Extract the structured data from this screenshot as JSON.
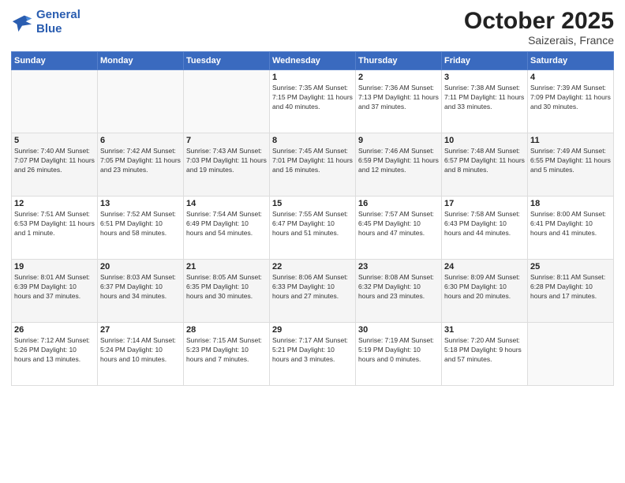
{
  "header": {
    "logo_line1": "General",
    "logo_line2": "Blue",
    "title": "October 2025",
    "subtitle": "Saizerais, France"
  },
  "weekdays": [
    "Sunday",
    "Monday",
    "Tuesday",
    "Wednesday",
    "Thursday",
    "Friday",
    "Saturday"
  ],
  "weeks": [
    [
      {
        "day": "",
        "info": ""
      },
      {
        "day": "",
        "info": ""
      },
      {
        "day": "",
        "info": ""
      },
      {
        "day": "1",
        "info": "Sunrise: 7:35 AM\nSunset: 7:15 PM\nDaylight: 11 hours\nand 40 minutes."
      },
      {
        "day": "2",
        "info": "Sunrise: 7:36 AM\nSunset: 7:13 PM\nDaylight: 11 hours\nand 37 minutes."
      },
      {
        "day": "3",
        "info": "Sunrise: 7:38 AM\nSunset: 7:11 PM\nDaylight: 11 hours\nand 33 minutes."
      },
      {
        "day": "4",
        "info": "Sunrise: 7:39 AM\nSunset: 7:09 PM\nDaylight: 11 hours\nand 30 minutes."
      }
    ],
    [
      {
        "day": "5",
        "info": "Sunrise: 7:40 AM\nSunset: 7:07 PM\nDaylight: 11 hours\nand 26 minutes."
      },
      {
        "day": "6",
        "info": "Sunrise: 7:42 AM\nSunset: 7:05 PM\nDaylight: 11 hours\nand 23 minutes."
      },
      {
        "day": "7",
        "info": "Sunrise: 7:43 AM\nSunset: 7:03 PM\nDaylight: 11 hours\nand 19 minutes."
      },
      {
        "day": "8",
        "info": "Sunrise: 7:45 AM\nSunset: 7:01 PM\nDaylight: 11 hours\nand 16 minutes."
      },
      {
        "day": "9",
        "info": "Sunrise: 7:46 AM\nSunset: 6:59 PM\nDaylight: 11 hours\nand 12 minutes."
      },
      {
        "day": "10",
        "info": "Sunrise: 7:48 AM\nSunset: 6:57 PM\nDaylight: 11 hours\nand 8 minutes."
      },
      {
        "day": "11",
        "info": "Sunrise: 7:49 AM\nSunset: 6:55 PM\nDaylight: 11 hours\nand 5 minutes."
      }
    ],
    [
      {
        "day": "12",
        "info": "Sunrise: 7:51 AM\nSunset: 6:53 PM\nDaylight: 11 hours\nand 1 minute."
      },
      {
        "day": "13",
        "info": "Sunrise: 7:52 AM\nSunset: 6:51 PM\nDaylight: 10 hours\nand 58 minutes."
      },
      {
        "day": "14",
        "info": "Sunrise: 7:54 AM\nSunset: 6:49 PM\nDaylight: 10 hours\nand 54 minutes."
      },
      {
        "day": "15",
        "info": "Sunrise: 7:55 AM\nSunset: 6:47 PM\nDaylight: 10 hours\nand 51 minutes."
      },
      {
        "day": "16",
        "info": "Sunrise: 7:57 AM\nSunset: 6:45 PM\nDaylight: 10 hours\nand 47 minutes."
      },
      {
        "day": "17",
        "info": "Sunrise: 7:58 AM\nSunset: 6:43 PM\nDaylight: 10 hours\nand 44 minutes."
      },
      {
        "day": "18",
        "info": "Sunrise: 8:00 AM\nSunset: 6:41 PM\nDaylight: 10 hours\nand 41 minutes."
      }
    ],
    [
      {
        "day": "19",
        "info": "Sunrise: 8:01 AM\nSunset: 6:39 PM\nDaylight: 10 hours\nand 37 minutes."
      },
      {
        "day": "20",
        "info": "Sunrise: 8:03 AM\nSunset: 6:37 PM\nDaylight: 10 hours\nand 34 minutes."
      },
      {
        "day": "21",
        "info": "Sunrise: 8:05 AM\nSunset: 6:35 PM\nDaylight: 10 hours\nand 30 minutes."
      },
      {
        "day": "22",
        "info": "Sunrise: 8:06 AM\nSunset: 6:33 PM\nDaylight: 10 hours\nand 27 minutes."
      },
      {
        "day": "23",
        "info": "Sunrise: 8:08 AM\nSunset: 6:32 PM\nDaylight: 10 hours\nand 23 minutes."
      },
      {
        "day": "24",
        "info": "Sunrise: 8:09 AM\nSunset: 6:30 PM\nDaylight: 10 hours\nand 20 minutes."
      },
      {
        "day": "25",
        "info": "Sunrise: 8:11 AM\nSunset: 6:28 PM\nDaylight: 10 hours\nand 17 minutes."
      }
    ],
    [
      {
        "day": "26",
        "info": "Sunrise: 7:12 AM\nSunset: 5:26 PM\nDaylight: 10 hours\nand 13 minutes."
      },
      {
        "day": "27",
        "info": "Sunrise: 7:14 AM\nSunset: 5:24 PM\nDaylight: 10 hours\nand 10 minutes."
      },
      {
        "day": "28",
        "info": "Sunrise: 7:15 AM\nSunset: 5:23 PM\nDaylight: 10 hours\nand 7 minutes."
      },
      {
        "day": "29",
        "info": "Sunrise: 7:17 AM\nSunset: 5:21 PM\nDaylight: 10 hours\nand 3 minutes."
      },
      {
        "day": "30",
        "info": "Sunrise: 7:19 AM\nSunset: 5:19 PM\nDaylight: 10 hours\nand 0 minutes."
      },
      {
        "day": "31",
        "info": "Sunrise: 7:20 AM\nSunset: 5:18 PM\nDaylight: 9 hours\nand 57 minutes."
      },
      {
        "day": "",
        "info": ""
      }
    ]
  ]
}
